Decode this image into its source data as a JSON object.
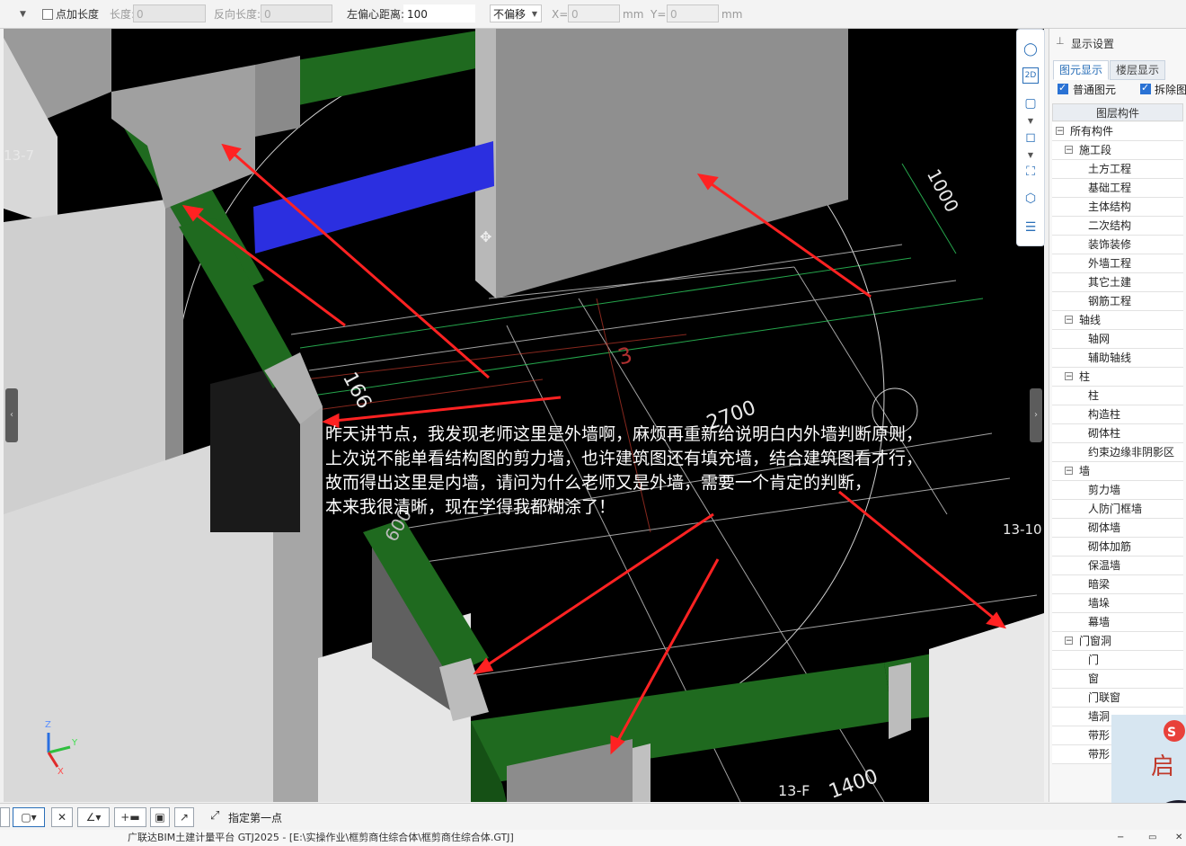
{
  "toolbar": {
    "point_length_label": "点加长度",
    "length_label": "长度:",
    "length_value": "0",
    "reverse_length_label": "反向长度:",
    "reverse_length_value": "0",
    "offset_label": "左偏心距离:",
    "offset_value": "100",
    "offset_mode": "不偏移",
    "x_label": "X=",
    "x_value": "0",
    "y_label": "Y=",
    "y_value": "0",
    "unit": "mm"
  },
  "viewport": {
    "axis_labels": {
      "grid_13_7": "13-7",
      "grid_13_f": "13-F",
      "grid_13_10": "13-10"
    },
    "dimensions": {
      "d1000": "1000",
      "d2700": "2700",
      "d1400": "1400",
      "d166": "166",
      "d3": "3",
      "d600": "600"
    },
    "annotation": {
      "line1": "昨天讲节点，我发现老师这里是外墙啊，麻烦再重新给说明白内外墙判断原则，",
      "line2": "上次说不能单看结构图的剪力墙，也许建筑图还有填充墙，结合建筑图看才行，",
      "line3": "故而得出这里是内墙，请问为什么老师又是外墙，需要一个肯定的判断，",
      "line4": "本来我很清晰，现在学得我都糊涂了！"
    },
    "gizmo": {
      "x": "X",
      "y": "Y",
      "z": "Z"
    },
    "colors": {
      "wall_gray": "#8f8f8f",
      "beam_green": "#1f6a1f",
      "beam_blue": "#2b2fe0",
      "arrow_red": "#ff2222",
      "dim_green": "#2fcf5f"
    }
  },
  "view_tools": [
    "orbit-icon",
    "2d-view-icon",
    "box-view-icon",
    "3d-view-icon",
    "zoom-extents-icon",
    "layer-view-icon",
    "properties-icon"
  ],
  "panel": {
    "title": "显示设置",
    "tabs": [
      "图元显示",
      "楼层显示"
    ],
    "checks": [
      {
        "label": "普通图元",
        "checked": true
      },
      {
        "label": "拆除图",
        "checked": true
      }
    ],
    "column_header": "图层构件",
    "tree": [
      {
        "label": "所有构件",
        "level": 0,
        "toggle": "−"
      },
      {
        "label": "施工段",
        "level": 1,
        "toggle": "−"
      },
      {
        "label": "土方工程",
        "level": 2
      },
      {
        "label": "基础工程",
        "level": 2
      },
      {
        "label": "主体结构",
        "level": 2
      },
      {
        "label": "二次结构",
        "level": 2
      },
      {
        "label": "装饰装修",
        "level": 2
      },
      {
        "label": "外墙工程",
        "level": 2
      },
      {
        "label": "其它土建",
        "level": 2
      },
      {
        "label": "钢筋工程",
        "level": 2
      },
      {
        "label": "轴线",
        "level": 1,
        "toggle": "−"
      },
      {
        "label": "轴网",
        "level": 2
      },
      {
        "label": "辅助轴线",
        "level": 2
      },
      {
        "label": "柱",
        "level": 1,
        "toggle": "−"
      },
      {
        "label": "柱",
        "level": 2
      },
      {
        "label": "构造柱",
        "level": 2
      },
      {
        "label": "砌体柱",
        "level": 2
      },
      {
        "label": "约束边缘非阴影区",
        "level": 2
      },
      {
        "label": "墙",
        "level": 1,
        "toggle": "−"
      },
      {
        "label": "剪力墙",
        "level": 2
      },
      {
        "label": "人防门框墙",
        "level": 2
      },
      {
        "label": "砌体墙",
        "level": 2
      },
      {
        "label": "砌体加筋",
        "level": 2
      },
      {
        "label": "保温墙",
        "level": 2
      },
      {
        "label": "暗梁",
        "level": 2
      },
      {
        "label": "墙垛",
        "level": 2
      },
      {
        "label": "幕墙",
        "level": 2
      },
      {
        "label": "门窗洞",
        "level": 1,
        "toggle": "−"
      },
      {
        "label": "门",
        "level": 2
      },
      {
        "label": "窗",
        "level": 2
      },
      {
        "label": "门联窗",
        "level": 2
      },
      {
        "label": "墙洞",
        "level": 2
      },
      {
        "label": "带形",
        "level": 2
      },
      {
        "label": "带形",
        "level": 2
      }
    ]
  },
  "bottom": {
    "hint": "指定第一点"
  },
  "status": {
    "title": "广联达BIM土建计量平台 GTJ2025 - [E:\\实操作业\\框剪商住综合体\\框剪商住综合体.GTJ]"
  }
}
